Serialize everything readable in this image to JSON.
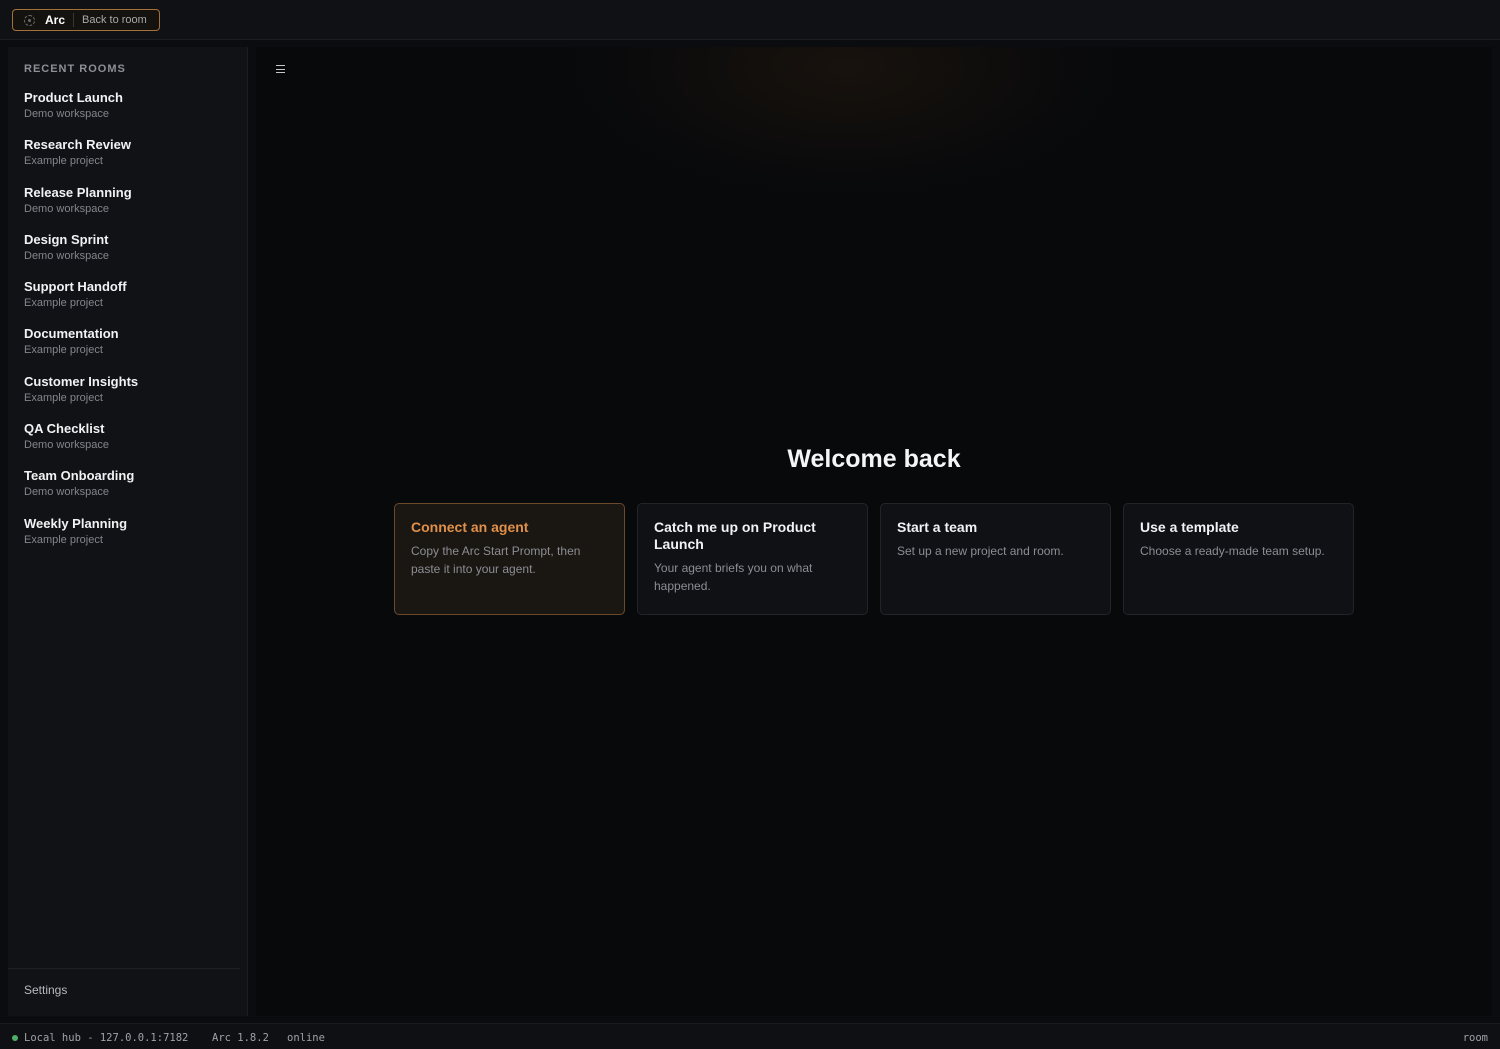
{
  "topbar": {
    "app_name": "Arc",
    "back_label": "Back to room"
  },
  "sidebar": {
    "heading": "RECENT ROOMS",
    "rooms": [
      {
        "title": "Product Launch",
        "subtitle": "Demo workspace"
      },
      {
        "title": "Research Review",
        "subtitle": "Example project"
      },
      {
        "title": "Release Planning",
        "subtitle": "Demo workspace"
      },
      {
        "title": "Design Sprint",
        "subtitle": "Demo workspace"
      },
      {
        "title": "Support Handoff",
        "subtitle": "Example project"
      },
      {
        "title": "Documentation",
        "subtitle": "Example project"
      },
      {
        "title": "Customer Insights",
        "subtitle": "Example project"
      },
      {
        "title": "QA Checklist",
        "subtitle": "Demo workspace"
      },
      {
        "title": "Team Onboarding",
        "subtitle": "Demo workspace"
      },
      {
        "title": "Weekly Planning",
        "subtitle": "Example project"
      }
    ],
    "settings_label": "Settings"
  },
  "main": {
    "menu_icon": "hamburger-icon",
    "welcome": "Welcome back",
    "cards": [
      {
        "title": "Connect an agent",
        "description": "Copy the Arc Start Prompt, then paste it into your agent."
      },
      {
        "title": "Catch me up on Product Launch",
        "description": "Your agent briefs you on what happened."
      },
      {
        "title": "Start a team",
        "description": "Set up a new project and room."
      },
      {
        "title": "Use a template",
        "description": "Choose a ready-made team setup."
      }
    ]
  },
  "statusbar": {
    "hub": "Local hub - 127.0.0.1:7182",
    "version": "Arc 1.8.2",
    "state": "online",
    "mode": "room"
  },
  "colors": {
    "accent": "#e0904a",
    "accent_border": "#a6703b",
    "status_online": "#4fae6a",
    "background": "#08090b"
  }
}
